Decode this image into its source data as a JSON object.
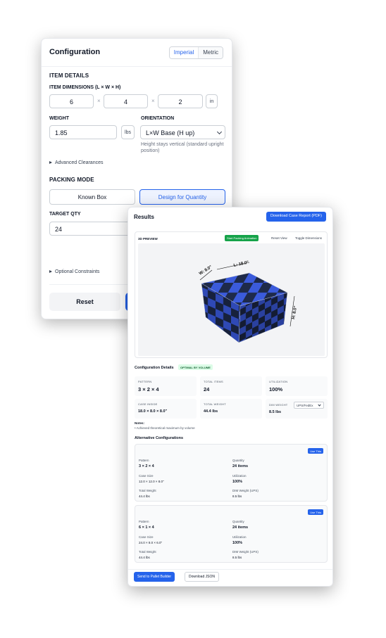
{
  "config": {
    "title": "Configuration",
    "units": {
      "imperial": "Imperial",
      "metric": "Metric"
    },
    "item_details": "ITEM DETAILS",
    "dims_label": "ITEM DIMENSIONS (L × W × H)",
    "dims": {
      "l": "6",
      "w": "4",
      "h": "2",
      "unit": "in",
      "sep": "×"
    },
    "weight_label": "WEIGHT",
    "weight_value": "1.85",
    "weight_unit": "lbs",
    "orientation_label": "ORIENTATION",
    "orientation_value": "L×W Base (H up)",
    "orientation_hint": "Height stays vertical (standard upright position)",
    "advanced": "Advanced Clearances",
    "packing_mode": "PACKING MODE",
    "mode_known": "Known Box",
    "mode_design": "Design for Quantity",
    "target_qty_label": "TARGET QTY",
    "target_qty_value": "24",
    "optional": "Optional Constraints",
    "reset": "Reset"
  },
  "results": {
    "title": "Results",
    "download_report": "Download Case Report (PDF)",
    "preview": {
      "label": "3D PREVIEW",
      "start_anim": "Start Packing Animation",
      "reset_view": "Reset View",
      "toggle_dims": "Toggle Dimensions",
      "dim_w": "W: 8.0\"",
      "dim_l": "L: 18.0\"",
      "dim_h": "H: 8.0\""
    },
    "config_details": "Configuration Details",
    "badge": "OPTIMAL BY VOLUME",
    "stats": {
      "pattern_k": "PATTERN",
      "pattern_v": "3 × 2 × 4",
      "items_k": "TOTAL ITEMS",
      "items_v": "24",
      "util_k": "UTILIZATION",
      "util_v": "100%",
      "inside_k": "CASE INSIDE",
      "inside_v": "18.0 × 8.0 × 8.0\"",
      "weight_k": "TOTAL WEIGHT",
      "weight_v": "44.4 lbs",
      "dim_k": "DIM WEIGHT",
      "dim_v": "8.5 lbs",
      "dim_sel": "UPS/FedEx"
    },
    "notes_k": "Notes:",
    "notes_v": "• Achieved theoretical maximum by volume",
    "alt_title": "Alternative Configurations",
    "alts": [
      {
        "use": "Use This",
        "pattern_k": "Pattern",
        "pattern": "3 × 2 × 4",
        "qty_k": "Quantity",
        "qty": "24 items",
        "case_k": "Case Size",
        "case": "12.0 × 12.0 × 8.0\"",
        "util_k": "Utilization",
        "util": "100%",
        "tw_k": "Total Weight",
        "tw": "44.4 lbs",
        "dw_k": "DIM Weight (UPS)",
        "dw": "8.5 lbs"
      },
      {
        "use": "Use This",
        "pattern_k": "Pattern",
        "pattern": "6 × 1 × 4",
        "qty_k": "Quantity",
        "qty": "24 items",
        "case_k": "Case Size",
        "case": "24.0 × 8.0 × 6.0\"",
        "util_k": "Utilization",
        "util": "100%",
        "tw_k": "Total Weight",
        "tw": "44.4 lbs",
        "dw_k": "DIM Weight (UPS)",
        "dw": "8.5 lbs"
      }
    ],
    "pallet_btn": "Send to Pallet Builder",
    "json_btn": "Download JSON"
  },
  "colors": {
    "accent": "#2563eb",
    "success": "#16a34a",
    "box_dark": "#1e2a4a",
    "box_light": "#3b5bdb"
  }
}
